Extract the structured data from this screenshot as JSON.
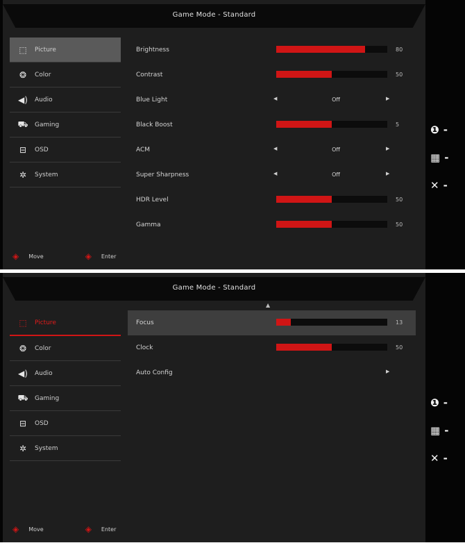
{
  "screens": [
    {
      "title": "Game Mode - Standard",
      "show_up_arrow": false,
      "sidebar": [
        {
          "icon": "picture-icon",
          "glyph": "⬚",
          "label": "Picture",
          "state": "grey"
        },
        {
          "icon": "color-icon",
          "glyph": "❂",
          "label": "Color",
          "state": ""
        },
        {
          "icon": "audio-icon",
          "glyph": "◀)",
          "label": "Audio",
          "state": ""
        },
        {
          "icon": "gaming-icon",
          "glyph": "⛟",
          "label": "Gaming",
          "state": ""
        },
        {
          "icon": "osd-icon",
          "glyph": "⊟",
          "label": "OSD",
          "state": ""
        },
        {
          "icon": "system-icon",
          "glyph": "✲",
          "label": "System",
          "state": ""
        }
      ],
      "rows": [
        {
          "type": "bar",
          "label": "Brightness",
          "level": 0.8,
          "value": "80"
        },
        {
          "type": "bar",
          "label": "Contrast",
          "level": 0.5,
          "value": "50"
        },
        {
          "type": "select",
          "label": "Blue Light",
          "value": "Off"
        },
        {
          "type": "bar",
          "label": "Black Boost",
          "level": 0.5,
          "value": "5"
        },
        {
          "type": "select",
          "label": "ACM",
          "value": "Off"
        },
        {
          "type": "select",
          "label": "Super Sharpness",
          "value": "Off"
        },
        {
          "type": "bar",
          "label": "HDR Level",
          "level": 0.5,
          "value": "50"
        },
        {
          "type": "bar",
          "label": "Gamma",
          "level": 0.5,
          "value": "50"
        }
      ],
      "footer": [
        {
          "icon": "move-icon",
          "label": "Move"
        },
        {
          "icon": "enter-icon",
          "label": "Enter"
        }
      ]
    },
    {
      "title": "Game Mode - Standard",
      "show_up_arrow": true,
      "sidebar": [
        {
          "icon": "picture-icon",
          "glyph": "⬚",
          "label": "Picture",
          "state": "red"
        },
        {
          "icon": "color-icon",
          "glyph": "❂",
          "label": "Color",
          "state": ""
        },
        {
          "icon": "audio-icon",
          "glyph": "◀)",
          "label": "Audio",
          "state": ""
        },
        {
          "icon": "gaming-icon",
          "glyph": "⛟",
          "label": "Gaming",
          "state": ""
        },
        {
          "icon": "osd-icon",
          "glyph": "⊟",
          "label": "OSD",
          "state": ""
        },
        {
          "icon": "system-icon",
          "glyph": "✲",
          "label": "System",
          "state": ""
        }
      ],
      "rows": [
        {
          "type": "bar",
          "label": "Focus",
          "level": 0.13,
          "value": "13",
          "highlight": true
        },
        {
          "type": "bar",
          "label": "Clock",
          "level": 0.5,
          "value": "50"
        },
        {
          "type": "select-right",
          "label": "Auto Config"
        }
      ],
      "footer": [
        {
          "icon": "move-icon",
          "label": "Move"
        },
        {
          "icon": "enter-icon",
          "label": "Enter"
        }
      ]
    }
  ],
  "side_keys": [
    {
      "icon": "info-icon",
      "glyph": "❶",
      "label": "-"
    },
    {
      "icon": "menu-icon",
      "glyph": "▦",
      "label": "-"
    },
    {
      "icon": "close-icon",
      "glyph": "✕",
      "label": "-"
    }
  ]
}
